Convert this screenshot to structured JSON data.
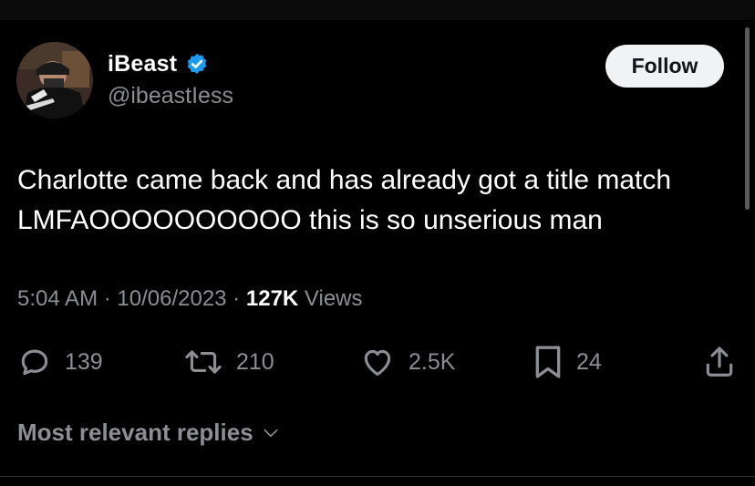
{
  "author": {
    "display_name": "iBeast",
    "handle": "@ibeastIess",
    "verified_icon": "verified-badge-icon",
    "verified_color": "#1d9bf0"
  },
  "follow_button": {
    "label": "Follow"
  },
  "tweet": {
    "lines": [
      "Charlotte came back and has already got a title match",
      "LMFAOOOOOOOOOO this is so unserious man"
    ]
  },
  "meta": {
    "time": "5:04 AM",
    "separator": "·",
    "date": "10/06/2023",
    "views_count": "127K",
    "views_label": "Views"
  },
  "actions": {
    "reply": {
      "icon": "reply-icon",
      "count": "139"
    },
    "retweet": {
      "icon": "retweet-icon",
      "count": "210"
    },
    "like": {
      "icon": "heart-icon",
      "count": "2.5K"
    },
    "bookmark": {
      "icon": "bookmark-icon",
      "count": "24"
    },
    "share": {
      "icon": "share-icon"
    }
  },
  "replies_filter": {
    "label": "Most relevant replies",
    "icon": "chevron-down-icon"
  },
  "colors": {
    "background": "#000000",
    "text_primary": "#ffffff",
    "text_secondary": "#8b8f94",
    "follow_bg": "#eff3f4",
    "divider": "#2f3336"
  }
}
